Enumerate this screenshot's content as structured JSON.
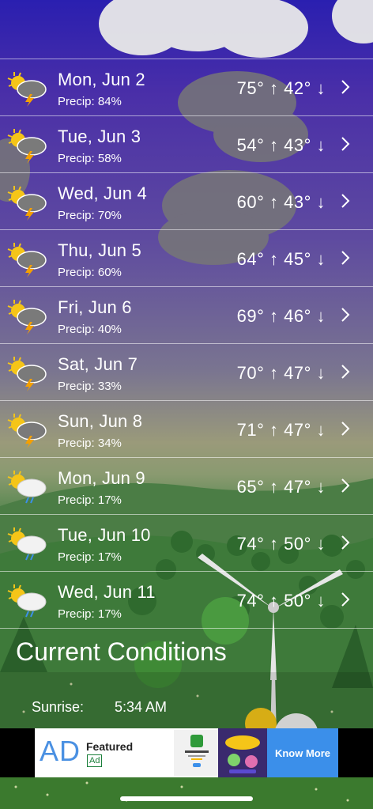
{
  "forecast": [
    {
      "day": "Mon, Jun 2",
      "precip": "Precip: 84%",
      "temps": "75° ↑  42° ↓",
      "icon": "thunderstorm-icon"
    },
    {
      "day": "Tue, Jun 3",
      "precip": "Precip: 58%",
      "temps": "54° ↑  43° ↓",
      "icon": "thunderstorm-icon"
    },
    {
      "day": "Wed, Jun 4",
      "precip": "Precip: 70%",
      "temps": "60° ↑  43° ↓",
      "icon": "thunderstorm-icon"
    },
    {
      "day": "Thu, Jun 5",
      "precip": "Precip: 60%",
      "temps": "64° ↑  45° ↓",
      "icon": "thunderstorm-icon"
    },
    {
      "day": "Fri, Jun 6",
      "precip": "Precip: 40%",
      "temps": "69° ↑  46° ↓",
      "icon": "thunderstorm-icon"
    },
    {
      "day": "Sat, Jun 7",
      "precip": "Precip: 33%",
      "temps": "70° ↑  47° ↓",
      "icon": "thunderstorm-icon"
    },
    {
      "day": "Sun, Jun 8",
      "precip": "Precip: 34%",
      "temps": "71° ↑  47° ↓",
      "icon": "thunderstorm-icon"
    },
    {
      "day": "Mon, Jun 9",
      "precip": "Precip: 17%",
      "temps": "65° ↑  47° ↓",
      "icon": "rain-partly-sunny-icon"
    },
    {
      "day": "Tue, Jun 10",
      "precip": "Precip: 17%",
      "temps": "74° ↑  50° ↓",
      "icon": "rain-partly-sunny-icon"
    },
    {
      "day": "Wed, Jun 11",
      "precip": "Precip: 17%",
      "temps": "74° ↑  50° ↓",
      "icon": "rain-partly-sunny-icon"
    }
  ],
  "current_conditions": {
    "title": "Current Conditions",
    "sunrise_label": "Sunrise:",
    "sunrise_value": "5:34 AM"
  },
  "ad": {
    "logo": "AD",
    "featured": "Featured",
    "tag": "Ad",
    "cta": "Know More"
  },
  "colors": {
    "accent_blue": "#3b8fea",
    "sun": "#f5c518",
    "lightning": "#f5a000"
  }
}
